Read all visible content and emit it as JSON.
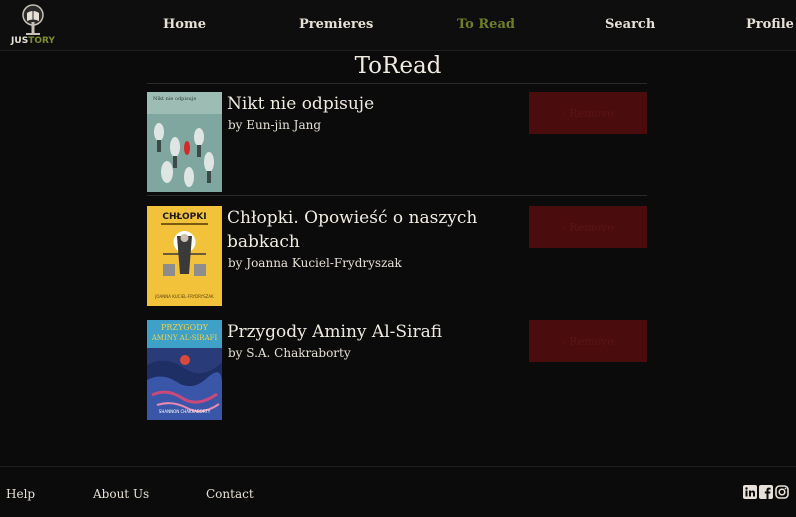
{
  "brand": {
    "name_part1": "JUS",
    "name_part2": "TORY",
    "colors": {
      "accent": "#6e8024",
      "remove_bg": "#4a0c0c"
    }
  },
  "nav": [
    {
      "label": "Home",
      "active": false
    },
    {
      "label": "Premieres",
      "active": false
    },
    {
      "label": "To Read",
      "active": true
    },
    {
      "label": "Search",
      "active": false
    },
    {
      "label": "Profile",
      "active": false
    }
  ],
  "page": {
    "title": "ToRead"
  },
  "books": [
    {
      "title": "Nikt nie odpisuje",
      "author": "by Eun-jin Jang",
      "remove_label": "- Remove"
    },
    {
      "title": "Chłopki. Opowieść o naszych babkach",
      "author": "by Joanna Kuciel-Frydryszak",
      "remove_label": "- Remove"
    },
    {
      "title": "Przygody Aminy Al-Sirafi",
      "author": "by S.A. Chakraborty",
      "remove_label": "- Remove"
    }
  ],
  "footer": {
    "links": [
      "Help",
      "About Us",
      "Contact"
    ],
    "social_icons": [
      "linkedin-icon",
      "facebook-icon",
      "instagram-icon"
    ]
  }
}
